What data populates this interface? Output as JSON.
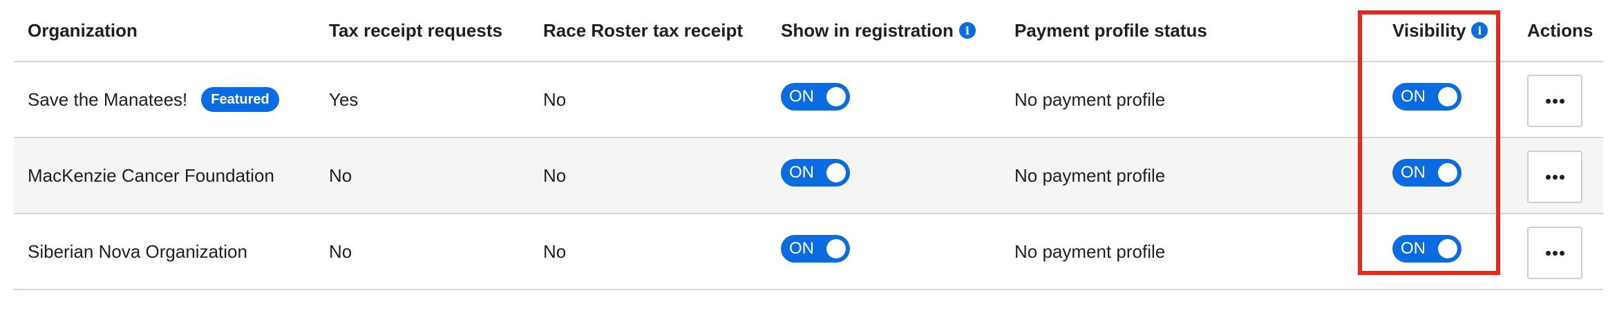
{
  "columns": {
    "organization": "Organization",
    "tax_receipt_requests": "Tax receipt requests",
    "race_roster_tax_receipt": "Race Roster tax receipt",
    "show_in_registration": "Show in registration",
    "payment_profile_status": "Payment profile status",
    "visibility": "Visibility",
    "actions": "Actions"
  },
  "info_icon_glyph": "i",
  "rows": [
    {
      "organization": "Save the Manatees!",
      "badge": "Featured",
      "tax_receipt_requests": "Yes",
      "race_roster_tax_receipt": "No",
      "show_in_registration": "ON",
      "payment_profile_status": "No payment profile",
      "visibility": "ON"
    },
    {
      "organization": "MacKenzie Cancer Foundation",
      "tax_receipt_requests": "No",
      "race_roster_tax_receipt": "No",
      "show_in_registration": "ON",
      "payment_profile_status": "No payment profile",
      "visibility": "ON"
    },
    {
      "organization": "Siberian Nova Organization",
      "tax_receipt_requests": "No",
      "race_roster_tax_receipt": "No",
      "show_in_registration": "ON",
      "payment_profile_status": "No payment profile",
      "visibility": "ON"
    }
  ],
  "colors": {
    "accent": "#0a6ce0",
    "highlight": "#e8261b",
    "alt_row": "#f5f5f5"
  }
}
